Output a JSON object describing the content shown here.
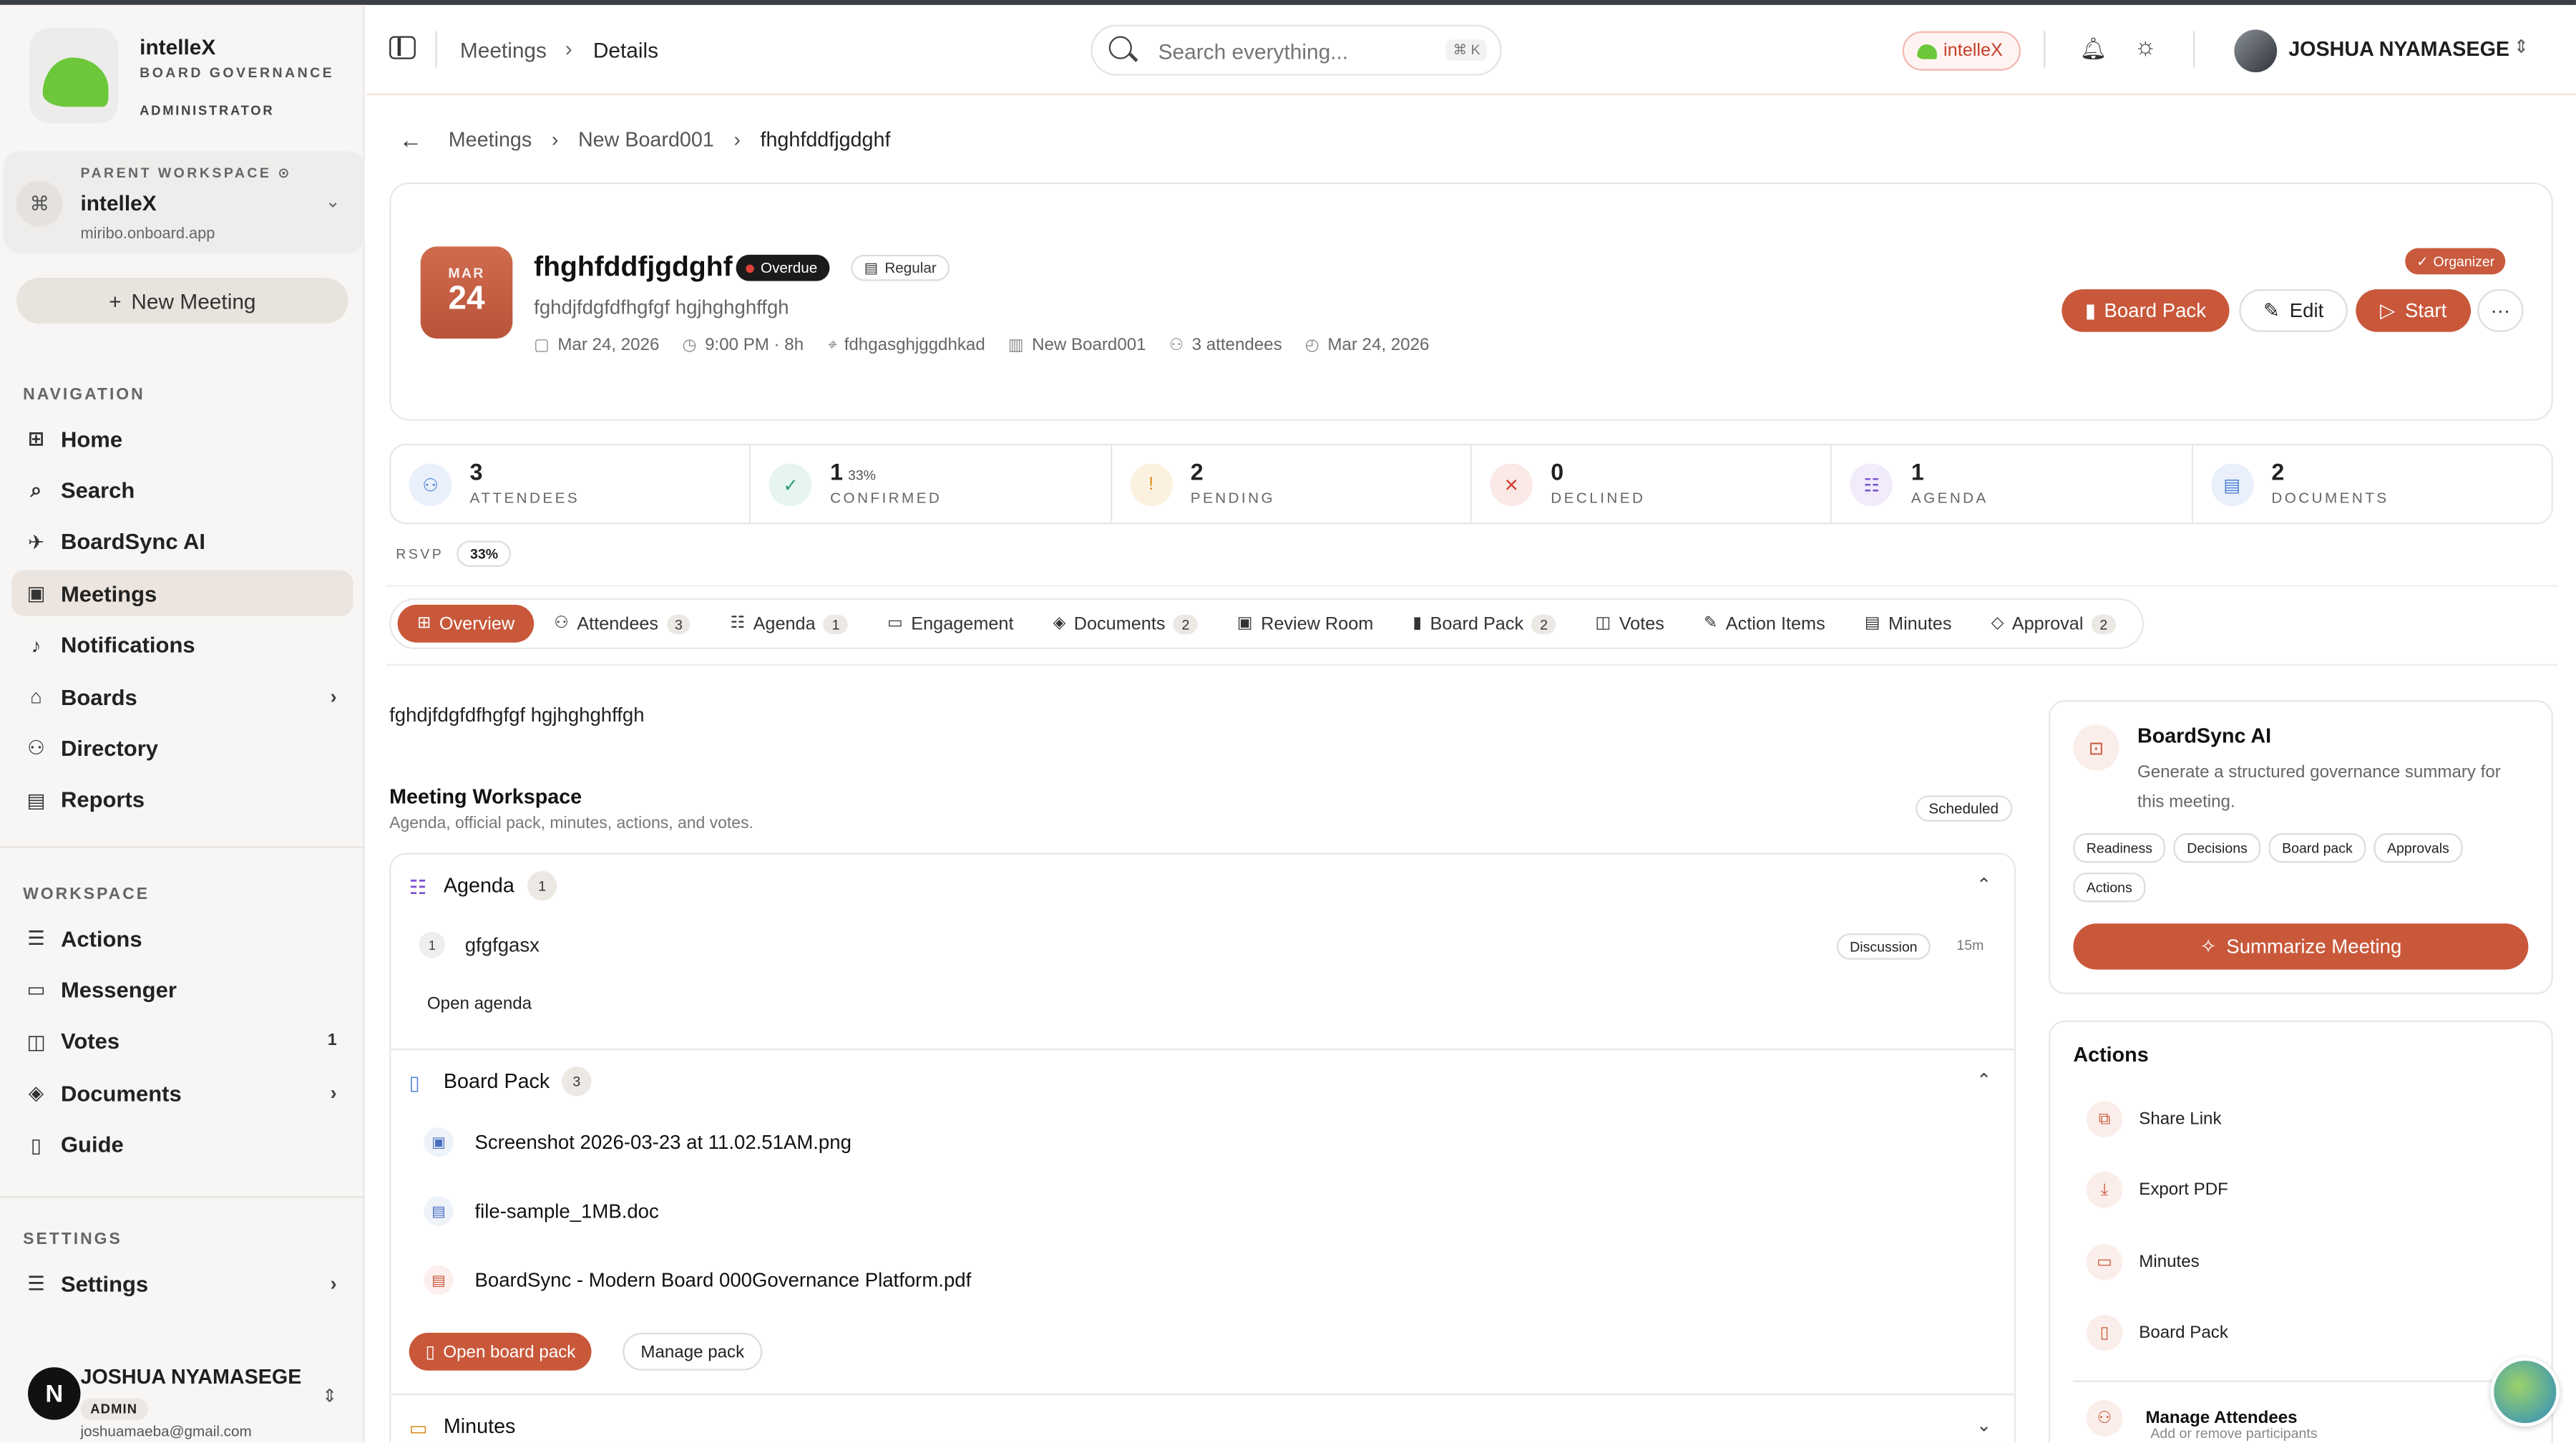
{
  "brand": {
    "name": "intelleX",
    "subtitle": "BOARD GOVERNANCE",
    "role": "ADMINISTRATOR"
  },
  "workspace": {
    "label": "PARENT WORKSPACE",
    "name": "intelleX",
    "url": "miribo.onboard.app"
  },
  "sidebar": {
    "new_meeting": "New Meeting",
    "nav_label": "NAVIGATION",
    "nav": [
      {
        "label": "Home",
        "icon": "grid-icon"
      },
      {
        "label": "Search",
        "icon": "search-icon"
      },
      {
        "label": "BoardSync AI",
        "icon": "bot-icon"
      },
      {
        "label": "Meetings",
        "icon": "calendar-icon",
        "active": true
      },
      {
        "label": "Notifications",
        "icon": "bell-icon"
      },
      {
        "label": "Boards",
        "icon": "building-icon"
      },
      {
        "label": "Directory",
        "icon": "users-icon"
      },
      {
        "label": "Reports",
        "icon": "file-icon"
      }
    ],
    "workspace_label": "WORKSPACE",
    "workspace_items": [
      {
        "label": "Actions",
        "icon": "list-icon"
      },
      {
        "label": "Messenger",
        "icon": "chat-icon"
      },
      {
        "label": "Votes",
        "icon": "vote-icon",
        "count": "1"
      },
      {
        "label": "Documents",
        "icon": "layers-icon"
      },
      {
        "label": "Guide",
        "icon": "book-icon"
      }
    ],
    "settings_label": "SETTINGS",
    "settings_item": "Settings"
  },
  "user": {
    "initial": "N",
    "name": "JOSHUA NYAMASEGE",
    "role": "ADMIN",
    "email": "joshuamaeba@gmail.com"
  },
  "header": {
    "crumb_1": "Meetings",
    "crumb_2": "Details",
    "search_placeholder": "Search everything...",
    "search_kbd": "⌘ K",
    "brand_chip": "intelleX",
    "user_name": "JOSHUA NYAMASEGE"
  },
  "breadcrumb": [
    "Meetings",
    "New Board001",
    "fhghfddfjgdghf"
  ],
  "meeting": {
    "month": "MAR",
    "day": "24",
    "title": "fhghfddfjgdghf",
    "status": "Overdue",
    "type": "Regular",
    "subtitle": "fghdjfdgfdfhgfgf hgjhghghffgh",
    "date": "Mar 24, 2026",
    "time": "9:00 PM · 8h",
    "location": "fdhgasghjggdhkad",
    "board": "New Board001",
    "attendees": "3 attendees",
    "deadline": "Mar 24, 2026",
    "organizer": "Organizer",
    "actions": {
      "board_pack": "Board Pack",
      "edit": "Edit",
      "start": "Start",
      "more": "···"
    }
  },
  "stats": [
    {
      "value": "3",
      "label": "ATTENDEES",
      "color": "#4a7fd6",
      "bg": "#e9f0fb"
    },
    {
      "value": "1",
      "pct": "33%",
      "label": "CONFIRMED",
      "color": "#2c9a72",
      "bg": "#e6f5ef"
    },
    {
      "value": "2",
      "label": "PENDING",
      "color": "#d88a1c",
      "bg": "#fcf1e0"
    },
    {
      "value": "0",
      "label": "DECLINED",
      "color": "#d0453a",
      "bg": "#fbe9e7"
    },
    {
      "value": "1",
      "label": "AGENDA",
      "color": "#7a4fd0",
      "bg": "#f1ebfb"
    },
    {
      "value": "2",
      "label": "DOCUMENTS",
      "color": "#4a7fd6",
      "bg": "#e9f0fb"
    }
  ],
  "rsvp": {
    "label": "RSVP",
    "value": "33%"
  },
  "tabs": [
    {
      "label": "Overview",
      "active": true
    },
    {
      "label": "Attendees",
      "count": "3"
    },
    {
      "label": "Agenda",
      "count": "1"
    },
    {
      "label": "Engagement"
    },
    {
      "label": "Documents",
      "count": "2"
    },
    {
      "label": "Review Room"
    },
    {
      "label": "Board Pack",
      "count": "2"
    },
    {
      "label": "Votes"
    },
    {
      "label": "Action Items"
    },
    {
      "label": "Minutes"
    },
    {
      "label": "Approval",
      "count": "2"
    }
  ],
  "overview": {
    "description": "fghdjfdgfdfhgfgf hgjhghghffgh",
    "workspace_title": "Meeting Workspace",
    "workspace_sub": "Agenda, official pack, minutes, actions, and votes.",
    "status": "Scheduled"
  },
  "agenda": {
    "title": "Agenda",
    "count": "1",
    "items": [
      {
        "num": "1",
        "title": "gfgfgasx",
        "tag": "Discussion",
        "duration": "15m"
      }
    ],
    "open_label": "Open agenda"
  },
  "board_pack": {
    "title": "Board Pack",
    "count": "3",
    "files": [
      {
        "name": "Screenshot 2026-03-23 at 11.02.51AM.png",
        "kind": "image"
      },
      {
        "name": "file-sample_1MB.doc",
        "kind": "doc"
      },
      {
        "name": "BoardSync - Modern Board 000Governance Platform.pdf",
        "kind": "pdf"
      }
    ],
    "open_label": "Open board pack",
    "manage_label": "Manage pack"
  },
  "minutes": {
    "title": "Minutes"
  },
  "ai": {
    "title": "BoardSync AI",
    "description": "Generate a structured governance summary for this meeting.",
    "chips": [
      "Readiness",
      "Decisions",
      "Board pack",
      "Approvals",
      "Actions"
    ],
    "button": "Summarize Meeting"
  },
  "actions_card": {
    "title": "Actions",
    "items": [
      "Share Link",
      "Export PDF",
      "Minutes",
      "Board Pack"
    ],
    "manage": "Manage Attendees",
    "manage_sub": "Add or remove participants"
  }
}
